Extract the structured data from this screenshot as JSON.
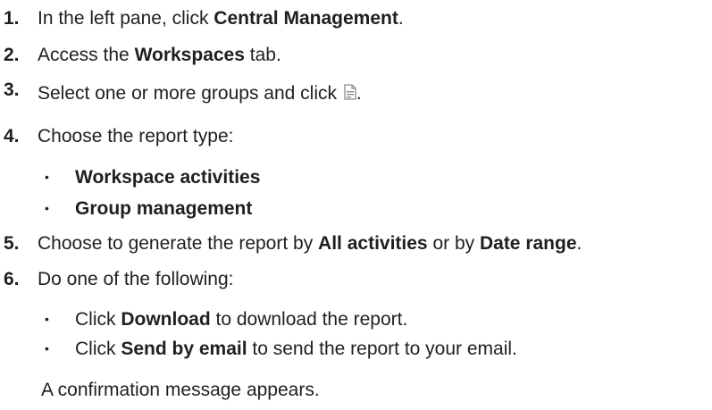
{
  "steps": [
    {
      "num": "1.",
      "pre": "In the left pane, click ",
      "bold": "Central Management",
      "post": "."
    },
    {
      "num": "2.",
      "pre": "Access the ",
      "bold": "Workspaces",
      "post": " tab."
    },
    {
      "num": "3.",
      "pre": "Select one or more groups and click ",
      "post": "."
    },
    {
      "num": "4.",
      "pre": "Choose the report type:"
    },
    {
      "num": "5.",
      "pre": "Choose to generate the report by ",
      "bold1": "All activities",
      "mid": " or by ",
      "bold2": "Date range",
      "post": "."
    },
    {
      "num": "6.",
      "pre": "Do one of the following:"
    }
  ],
  "report_types": [
    "Workspace activities",
    "Group management"
  ],
  "options": [
    {
      "pre": "Click ",
      "bold": "Download",
      "post": " to download the report."
    },
    {
      "pre": "Click ",
      "bold": "Send by email",
      "post": " to send the report to your email."
    }
  ],
  "bullet_glyph": "•",
  "confirmation": "A confirmation message appears.",
  "icons": {
    "report": "document-report-icon"
  },
  "colors": {
    "text": "#1f1f1f",
    "icon_stroke": "#8a8a8a"
  }
}
